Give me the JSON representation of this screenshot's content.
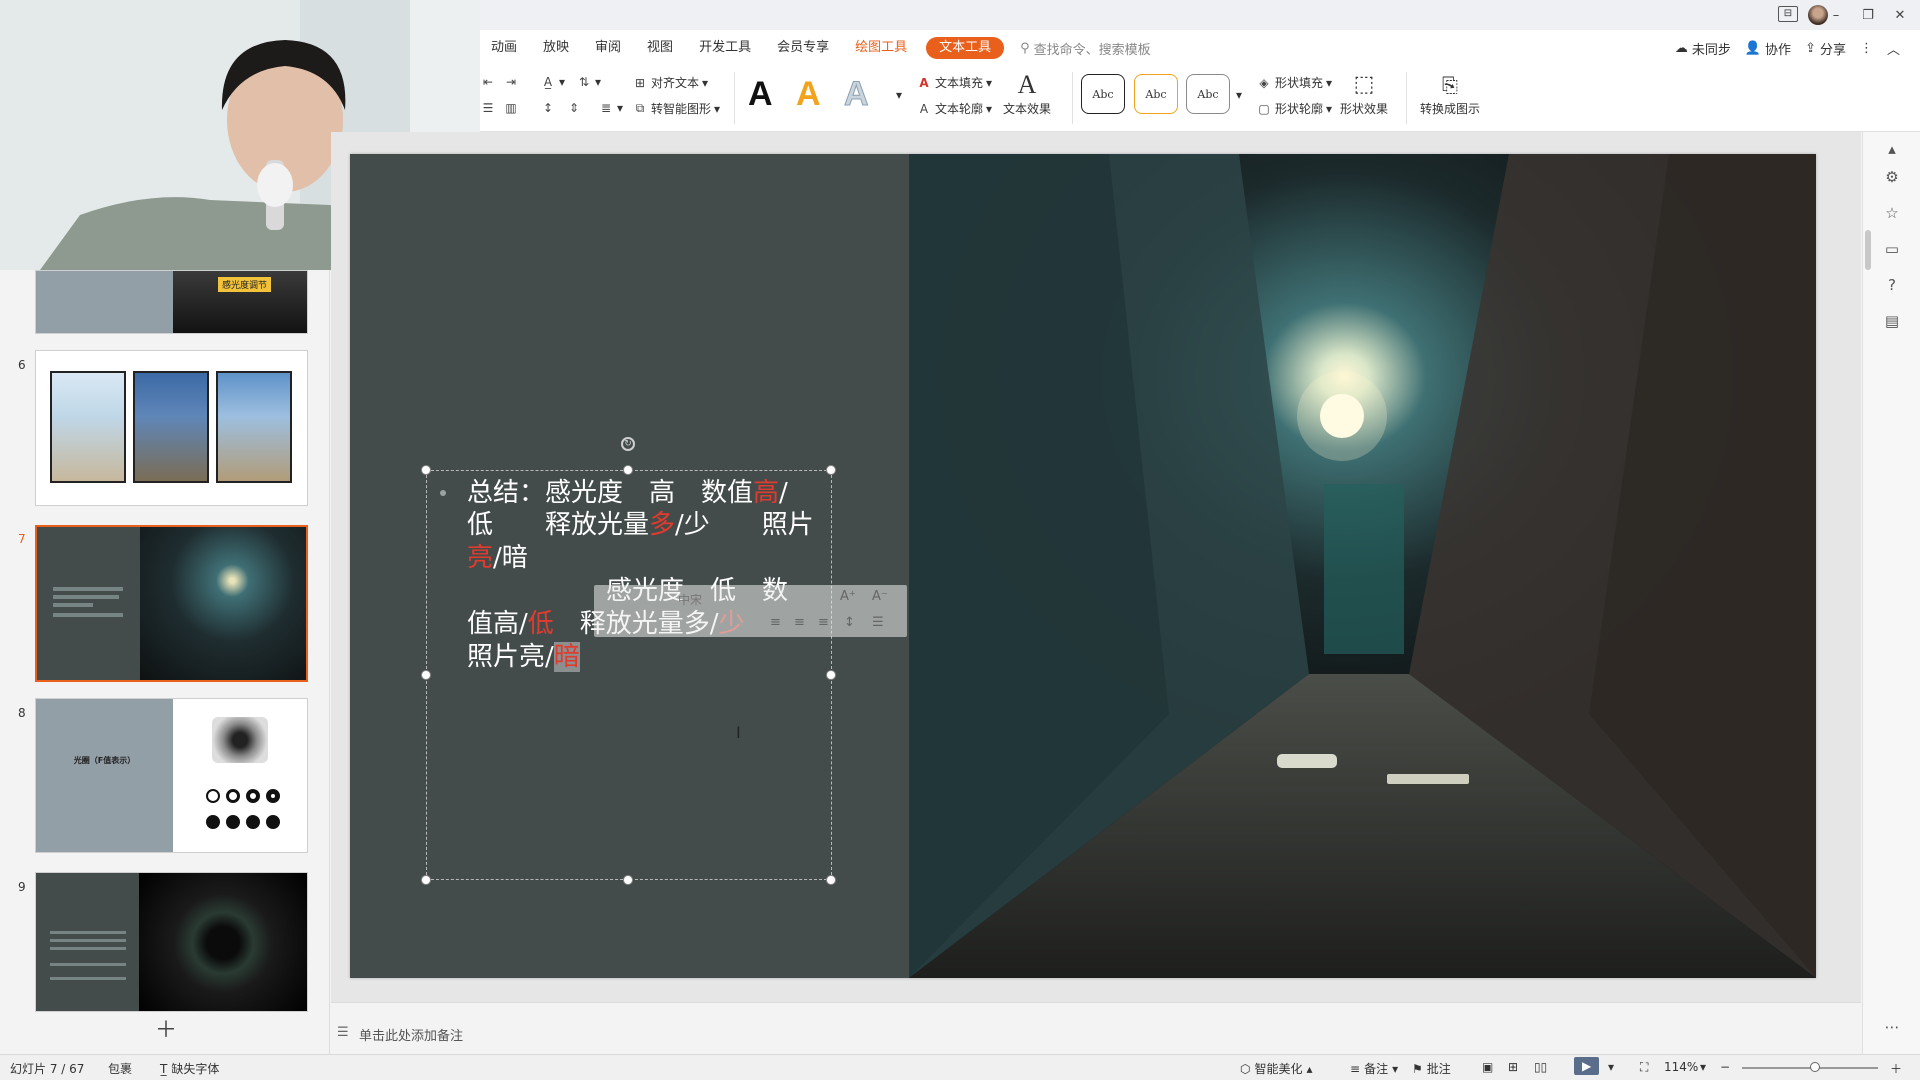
{
  "menu": {
    "tabs": [
      "动画",
      "放映",
      "审阅",
      "视图",
      "开发工具",
      "会员专享",
      "绘图工具",
      "文本工具"
    ],
    "search_placeholder": "查找命令、搜索模板",
    "right": {
      "sync": "未同步",
      "collaborate": "协作",
      "share": "分享"
    }
  },
  "ribbon": {
    "align_text": "对齐文本",
    "smart_shape": "转智能图形",
    "text_fill": "文本填充",
    "text_outline": "文本轮廓",
    "text_effect": "文本效果",
    "shape_fill": "形状填充",
    "shape_outline": "形状轮廓",
    "shape_effect": "形状效果",
    "convert_diagram": "转换成图示",
    "abc_label": "Abc",
    "big_a": "A",
    "accent_color": "#e8601c"
  },
  "thumbnails": {
    "numbers": [
      "6",
      "7",
      "8",
      "9"
    ],
    "slide5_label": "感光度调节",
    "slide8_title": "光圈（F值表示）"
  },
  "slide": {
    "line1_a": "总结：感光度　高　数值",
    "line1_red": "高",
    "line1_b": "/",
    "line2_a": "低　　释放光量",
    "line2_red": "多",
    "line2_b": "/少　　照片",
    "line3_red": "亮",
    "line3_b": "/暗",
    "line4": "感光度　低　数",
    "line5_a": "值高/",
    "line5_red": "低",
    "line5_b": "　释放光量多/",
    "line5_red2": "少",
    "line6_a": "照片亮/",
    "line6_sel": "暗",
    "mini_font": "中宋"
  },
  "notes": {
    "placeholder": "单击此处添加备注"
  },
  "status": {
    "slide_counter": "幻灯片 7 / 67",
    "theme": "包裹",
    "missing_font": "缺失字体",
    "smart_beautify": "智能美化",
    "notes_btn": "备注",
    "comment_btn": "批注",
    "zoom": "114%"
  }
}
